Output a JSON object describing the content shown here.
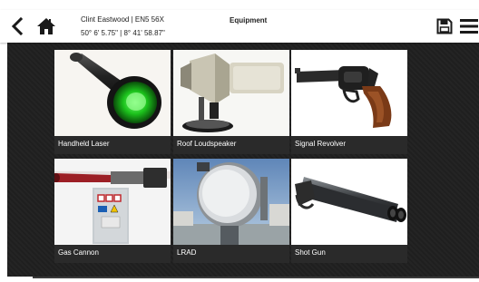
{
  "header": {
    "user_name": "Clint Eastwood | EN5 56X",
    "coordinates": "50° 6' 5.75\" | 8° 41' 58.87\"",
    "title": "Equipment",
    "icons": [
      "back-arrow-icon",
      "home-icon",
      "save-icon",
      "hamburger-menu-icon"
    ]
  },
  "equipment": [
    {
      "label": "Handheld Laser"
    },
    {
      "label": "Roof Loudspeaker"
    },
    {
      "label": "Signal Revolver"
    },
    {
      "label": "Gas Cannon"
    },
    {
      "label": "LRAD"
    },
    {
      "label": "Shot Gun"
    }
  ]
}
